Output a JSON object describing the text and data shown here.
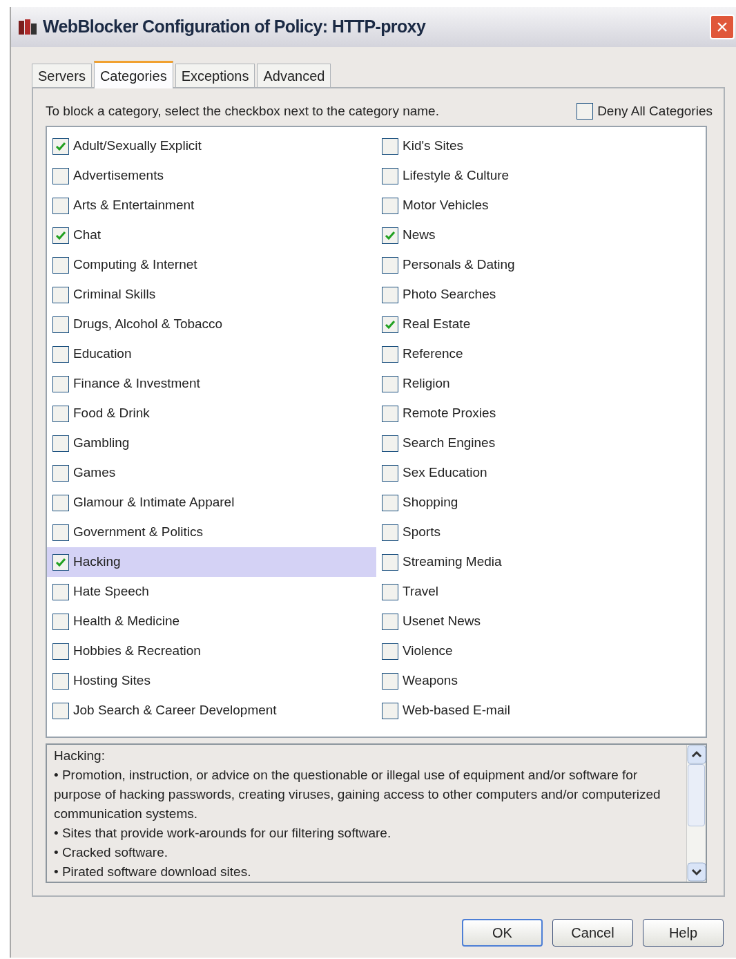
{
  "window": {
    "title": "WebBlocker Configuration of Policy: HTTP-proxy",
    "close": "×"
  },
  "tabs": [
    {
      "label": "Servers",
      "selected": false
    },
    {
      "label": "Categories",
      "selected": true
    },
    {
      "label": "Exceptions",
      "selected": false
    },
    {
      "label": "Advanced",
      "selected": false
    }
  ],
  "instruction": "To block a category, select the checkbox next to the category name.",
  "deny_all": {
    "label": "Deny All Categories",
    "checked": false
  },
  "categories": [
    {
      "label": "Adult/Sexually Explicit",
      "checked": true,
      "selected": false
    },
    {
      "label": "Advertisements",
      "checked": false,
      "selected": false
    },
    {
      "label": "Arts & Entertainment",
      "checked": false,
      "selected": false
    },
    {
      "label": "Chat",
      "checked": true,
      "selected": false
    },
    {
      "label": "Computing & Internet",
      "checked": false,
      "selected": false
    },
    {
      "label": "Criminal Skills",
      "checked": false,
      "selected": false
    },
    {
      "label": "Drugs, Alcohol & Tobacco",
      "checked": false,
      "selected": false
    },
    {
      "label": "Education",
      "checked": false,
      "selected": false
    },
    {
      "label": "Finance & Investment",
      "checked": false,
      "selected": false
    },
    {
      "label": "Food & Drink",
      "checked": false,
      "selected": false
    },
    {
      "label": "Gambling",
      "checked": false,
      "selected": false
    },
    {
      "label": "Games",
      "checked": false,
      "selected": false
    },
    {
      "label": "Glamour & Intimate Apparel",
      "checked": false,
      "selected": false
    },
    {
      "label": "Government & Politics",
      "checked": false,
      "selected": false
    },
    {
      "label": "Hacking",
      "checked": true,
      "selected": true
    },
    {
      "label": "Hate Speech",
      "checked": false,
      "selected": false
    },
    {
      "label": "Health & Medicine",
      "checked": false,
      "selected": false
    },
    {
      "label": "Hobbies & Recreation",
      "checked": false,
      "selected": false
    },
    {
      "label": "Hosting Sites",
      "checked": false,
      "selected": false
    },
    {
      "label": "Job Search & Career Development",
      "checked": false,
      "selected": false
    },
    {
      "label": "Kid's Sites",
      "checked": false,
      "selected": false
    },
    {
      "label": "Lifestyle & Culture",
      "checked": false,
      "selected": false
    },
    {
      "label": "Motor Vehicles",
      "checked": false,
      "selected": false
    },
    {
      "label": "News",
      "checked": true,
      "selected": false
    },
    {
      "label": "Personals & Dating",
      "checked": false,
      "selected": false
    },
    {
      "label": "Photo Searches",
      "checked": false,
      "selected": false
    },
    {
      "label": "Real Estate",
      "checked": true,
      "selected": false
    },
    {
      "label": "Reference",
      "checked": false,
      "selected": false
    },
    {
      "label": "Religion",
      "checked": false,
      "selected": false
    },
    {
      "label": "Remote Proxies",
      "checked": false,
      "selected": false
    },
    {
      "label": "Search Engines",
      "checked": false,
      "selected": false
    },
    {
      "label": "Sex Education",
      "checked": false,
      "selected": false
    },
    {
      "label": "Shopping",
      "checked": false,
      "selected": false
    },
    {
      "label": "Sports",
      "checked": false,
      "selected": false
    },
    {
      "label": "Streaming Media",
      "checked": false,
      "selected": false
    },
    {
      "label": "Travel",
      "checked": false,
      "selected": false
    },
    {
      "label": "Usenet News",
      "checked": false,
      "selected": false
    },
    {
      "label": "Violence",
      "checked": false,
      "selected": false
    },
    {
      "label": "Weapons",
      "checked": false,
      "selected": false
    },
    {
      "label": "Web-based E-mail",
      "checked": false,
      "selected": false
    }
  ],
  "description": {
    "title": "Hacking:",
    "lines": [
      "• Promotion, instruction, or advice on the questionable or illegal use of equipment and/or software for purpose of hacking passwords, creating viruses, gaining access to other computers and/or computerized communication systems.",
      "• Sites that provide work-arounds for our filtering software.",
      "• Cracked software.",
      "• Pirated software download sites."
    ]
  },
  "buttons": [
    "OK",
    "Cancel",
    "Help"
  ]
}
